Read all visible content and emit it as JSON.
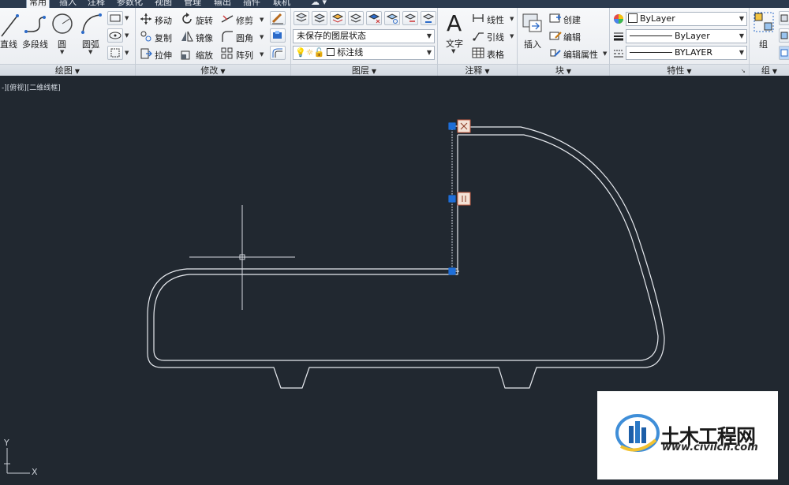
{
  "tabs": [
    "常用",
    "插入",
    "注释",
    "参数化",
    "视图",
    "管理",
    "输出",
    "插件",
    "联机"
  ],
  "active_tab": "常用",
  "panels": {
    "draw": {
      "title": "绘图",
      "line": "直线",
      "polyline": "多段线",
      "circle": "圆",
      "arc": "圆弧"
    },
    "modify": {
      "title": "修改",
      "move": "移动",
      "rotate": "旋转",
      "trim": "修剪",
      "copy": "复制",
      "mirror": "镜像",
      "fillet": "圆角",
      "stretch": "拉伸",
      "scale": "缩放",
      "array": "阵列"
    },
    "layers": {
      "title": "图层",
      "layer_state": "未保存的图层状态",
      "current_layer": "标注线"
    },
    "annotation": {
      "title": "注释",
      "text": "文字",
      "linear": "线性",
      "leader": "引线",
      "table": "表格"
    },
    "block": {
      "title": "块",
      "insert": "插入",
      "create": "创建",
      "edit": "编辑",
      "edit_attributes": "编辑属性"
    },
    "properties": {
      "title": "特性",
      "color": "ByLayer",
      "linetype": "ByLayer",
      "lineweight": "BYLAYER"
    },
    "group": {
      "title": "组",
      "group": "组"
    }
  },
  "viewport_label": "-][俯视][二维线框]",
  "ucs": {
    "x_label": "X",
    "y_label": "Y"
  },
  "watermark": {
    "title": "土木工程网",
    "url": "www.civilcn.com"
  },
  "colors": {
    "background": "#212830",
    "ribbon": "#eceff3",
    "grip": "#1e6fd9",
    "geometry": "#e6e9ee"
  }
}
